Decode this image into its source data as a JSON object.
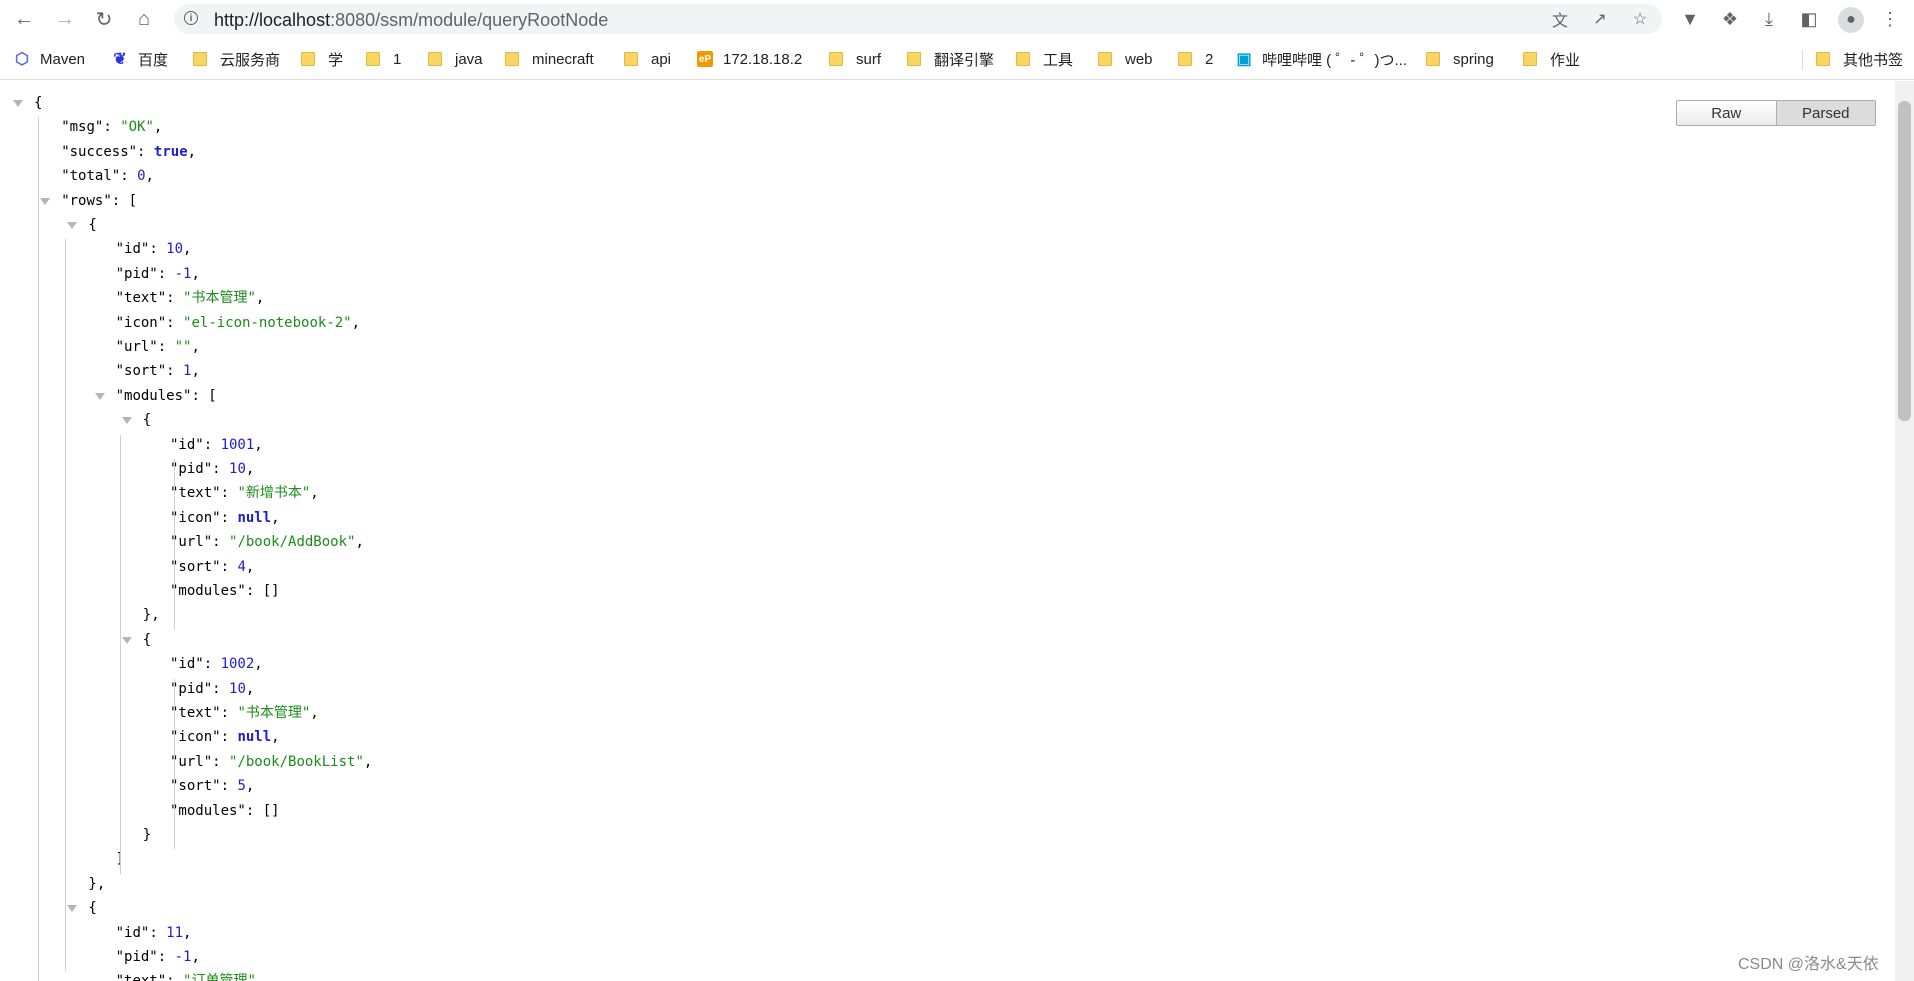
{
  "browser": {
    "url_host": "http://localhost",
    "url_rest": ":8080/ssm/module/queryRootNode"
  },
  "bookmarks": [
    {
      "label": "Maven",
      "icon": "maven-hexagon-icon",
      "color": "#5b6bd6"
    },
    {
      "label": "百度",
      "icon": "baidu-paw-icon",
      "color": "#2932e1"
    },
    {
      "label": "云服务商",
      "icon": "folder-icon"
    },
    {
      "label": "学",
      "icon": "folder-icon"
    },
    {
      "label": "1",
      "icon": "folder-icon"
    },
    {
      "label": "java",
      "icon": "folder-icon"
    },
    {
      "label": "minecraft",
      "icon": "folder-icon"
    },
    {
      "label": "api",
      "icon": "folder-icon"
    },
    {
      "label": "172.18.18.2",
      "icon": "ep-icon",
      "color": "#f39800"
    },
    {
      "label": "surf",
      "icon": "folder-icon"
    },
    {
      "label": "翻译引擎",
      "icon": "folder-icon"
    },
    {
      "label": "工具",
      "icon": "folder-icon"
    },
    {
      "label": "web",
      "icon": "folder-icon"
    },
    {
      "label": "2",
      "icon": "folder-icon"
    },
    {
      "label": "哔哩哔哩 ( ゜- ゜)つ...",
      "icon": "bilibili-tv-icon",
      "color": "#00a1d6"
    },
    {
      "label": "spring",
      "icon": "folder-icon"
    },
    {
      "label": "作业",
      "icon": "folder-icon"
    },
    {
      "label": "其他书签",
      "icon": "folder-icon"
    }
  ],
  "viewer": {
    "raw_label": "Raw",
    "parsed_label": "Parsed",
    "active_mode": "Parsed"
  },
  "json_lines": [
    {
      "indent": 0,
      "tri": true,
      "parts": [
        [
          "p",
          "{"
        ]
      ]
    },
    {
      "indent": 1,
      "parts": [
        [
          "k",
          "\"msg\""
        ],
        [
          "p",
          ":  "
        ],
        [
          "s",
          "\"OK\""
        ],
        [
          "p",
          ","
        ]
      ]
    },
    {
      "indent": 1,
      "parts": [
        [
          "k",
          "\"success\""
        ],
        [
          "p",
          ":  "
        ],
        [
          "b",
          "true"
        ],
        [
          "p",
          ","
        ]
      ]
    },
    {
      "indent": 1,
      "parts": [
        [
          "k",
          "\"total\""
        ],
        [
          "p",
          ":  "
        ],
        [
          "n",
          "0"
        ],
        [
          "p",
          ","
        ]
      ]
    },
    {
      "indent": 1,
      "tri": true,
      "parts": [
        [
          "k",
          "\"rows\""
        ],
        [
          "p",
          ":  ["
        ]
      ]
    },
    {
      "indent": 2,
      "tri": true,
      "parts": [
        [
          "p",
          "{"
        ]
      ]
    },
    {
      "indent": 3,
      "parts": [
        [
          "k",
          "\"id\""
        ],
        [
          "p",
          ":  "
        ],
        [
          "n",
          "10"
        ],
        [
          "p",
          ","
        ]
      ]
    },
    {
      "indent": 3,
      "parts": [
        [
          "k",
          "\"pid\""
        ],
        [
          "p",
          ":  "
        ],
        [
          "n",
          "-1"
        ],
        [
          "p",
          ","
        ]
      ]
    },
    {
      "indent": 3,
      "parts": [
        [
          "k",
          "\"text\""
        ],
        [
          "p",
          ":  "
        ],
        [
          "s",
          "\"书本管理\""
        ],
        [
          "p",
          ","
        ]
      ]
    },
    {
      "indent": 3,
      "parts": [
        [
          "k",
          "\"icon\""
        ],
        [
          "p",
          ":  "
        ],
        [
          "s",
          "\"el-icon-notebook-2\""
        ],
        [
          "p",
          ","
        ]
      ]
    },
    {
      "indent": 3,
      "parts": [
        [
          "k",
          "\"url\""
        ],
        [
          "p",
          ":  "
        ],
        [
          "s",
          "\"\""
        ],
        [
          "p",
          ","
        ]
      ]
    },
    {
      "indent": 3,
      "parts": [
        [
          "k",
          "\"sort\""
        ],
        [
          "p",
          ":  "
        ],
        [
          "n",
          "1"
        ],
        [
          "p",
          ","
        ]
      ]
    },
    {
      "indent": 3,
      "tri": true,
      "parts": [
        [
          "k",
          "\"modules\""
        ],
        [
          "p",
          ":  ["
        ]
      ]
    },
    {
      "indent": 4,
      "tri": true,
      "parts": [
        [
          "p",
          "{"
        ]
      ]
    },
    {
      "indent": 5,
      "parts": [
        [
          "k",
          "\"id\""
        ],
        [
          "p",
          ":  "
        ],
        [
          "n",
          "1001"
        ],
        [
          "p",
          ","
        ]
      ]
    },
    {
      "indent": 5,
      "parts": [
        [
          "k",
          "\"pid\""
        ],
        [
          "p",
          ":  "
        ],
        [
          "n",
          "10"
        ],
        [
          "p",
          ","
        ]
      ]
    },
    {
      "indent": 5,
      "parts": [
        [
          "k",
          "\"text\""
        ],
        [
          "p",
          ":  "
        ],
        [
          "s",
          "\"新增书本\""
        ],
        [
          "p",
          ","
        ]
      ]
    },
    {
      "indent": 5,
      "parts": [
        [
          "k",
          "\"icon\""
        ],
        [
          "p",
          ":  "
        ],
        [
          "b",
          "null"
        ],
        [
          "p",
          ","
        ]
      ]
    },
    {
      "indent": 5,
      "parts": [
        [
          "k",
          "\"url\""
        ],
        [
          "p",
          ":  "
        ],
        [
          "s",
          "\"/book/AddBook\""
        ],
        [
          "p",
          ","
        ]
      ]
    },
    {
      "indent": 5,
      "parts": [
        [
          "k",
          "\"sort\""
        ],
        [
          "p",
          ":  "
        ],
        [
          "n",
          "4"
        ],
        [
          "p",
          ","
        ]
      ]
    },
    {
      "indent": 5,
      "parts": [
        [
          "k",
          "\"modules\""
        ],
        [
          "p",
          ":  []"
        ]
      ]
    },
    {
      "indent": 4,
      "parts": [
        [
          "p",
          "},"
        ]
      ]
    },
    {
      "indent": 4,
      "tri": true,
      "parts": [
        [
          "p",
          "{"
        ]
      ]
    },
    {
      "indent": 5,
      "parts": [
        [
          "k",
          "\"id\""
        ],
        [
          "p",
          ":  "
        ],
        [
          "n",
          "1002"
        ],
        [
          "p",
          ","
        ]
      ]
    },
    {
      "indent": 5,
      "parts": [
        [
          "k",
          "\"pid\""
        ],
        [
          "p",
          ":  "
        ],
        [
          "n",
          "10"
        ],
        [
          "p",
          ","
        ]
      ]
    },
    {
      "indent": 5,
      "parts": [
        [
          "k",
          "\"text\""
        ],
        [
          "p",
          ":  "
        ],
        [
          "s",
          "\"书本管理\""
        ],
        [
          "p",
          ","
        ]
      ]
    },
    {
      "indent": 5,
      "parts": [
        [
          "k",
          "\"icon\""
        ],
        [
          "p",
          ":  "
        ],
        [
          "b",
          "null"
        ],
        [
          "p",
          ","
        ]
      ]
    },
    {
      "indent": 5,
      "parts": [
        [
          "k",
          "\"url\""
        ],
        [
          "p",
          ":  "
        ],
        [
          "s",
          "\"/book/BookList\""
        ],
        [
          "p",
          ","
        ]
      ]
    },
    {
      "indent": 5,
      "parts": [
        [
          "k",
          "\"sort\""
        ],
        [
          "p",
          ":  "
        ],
        [
          "n",
          "5"
        ],
        [
          "p",
          ","
        ]
      ]
    },
    {
      "indent": 5,
      "parts": [
        [
          "k",
          "\"modules\""
        ],
        [
          "p",
          ":  []"
        ]
      ]
    },
    {
      "indent": 4,
      "parts": [
        [
          "p",
          "}"
        ]
      ]
    },
    {
      "indent": 3,
      "parts": [
        [
          "p",
          "]"
        ]
      ]
    },
    {
      "indent": 2,
      "parts": [
        [
          "p",
          "},"
        ]
      ]
    },
    {
      "indent": 2,
      "tri": true,
      "parts": [
        [
          "p",
          "{"
        ]
      ]
    },
    {
      "indent": 3,
      "parts": [
        [
          "k",
          "\"id\""
        ],
        [
          "p",
          ":  "
        ],
        [
          "n",
          "11"
        ],
        [
          "p",
          ","
        ]
      ]
    },
    {
      "indent": 3,
      "parts": [
        [
          "k",
          "\"pid\""
        ],
        [
          "p",
          ":  "
        ],
        [
          "n",
          "-1"
        ],
        [
          "p",
          ","
        ]
      ]
    },
    {
      "indent": 3,
      "parts": [
        [
          "k",
          "\"text\""
        ],
        [
          "p",
          ":  "
        ],
        [
          "s",
          "\"订单管理\""
        ],
        [
          "p",
          ","
        ]
      ]
    }
  ],
  "watermark": "CSDN @洛水&天依"
}
